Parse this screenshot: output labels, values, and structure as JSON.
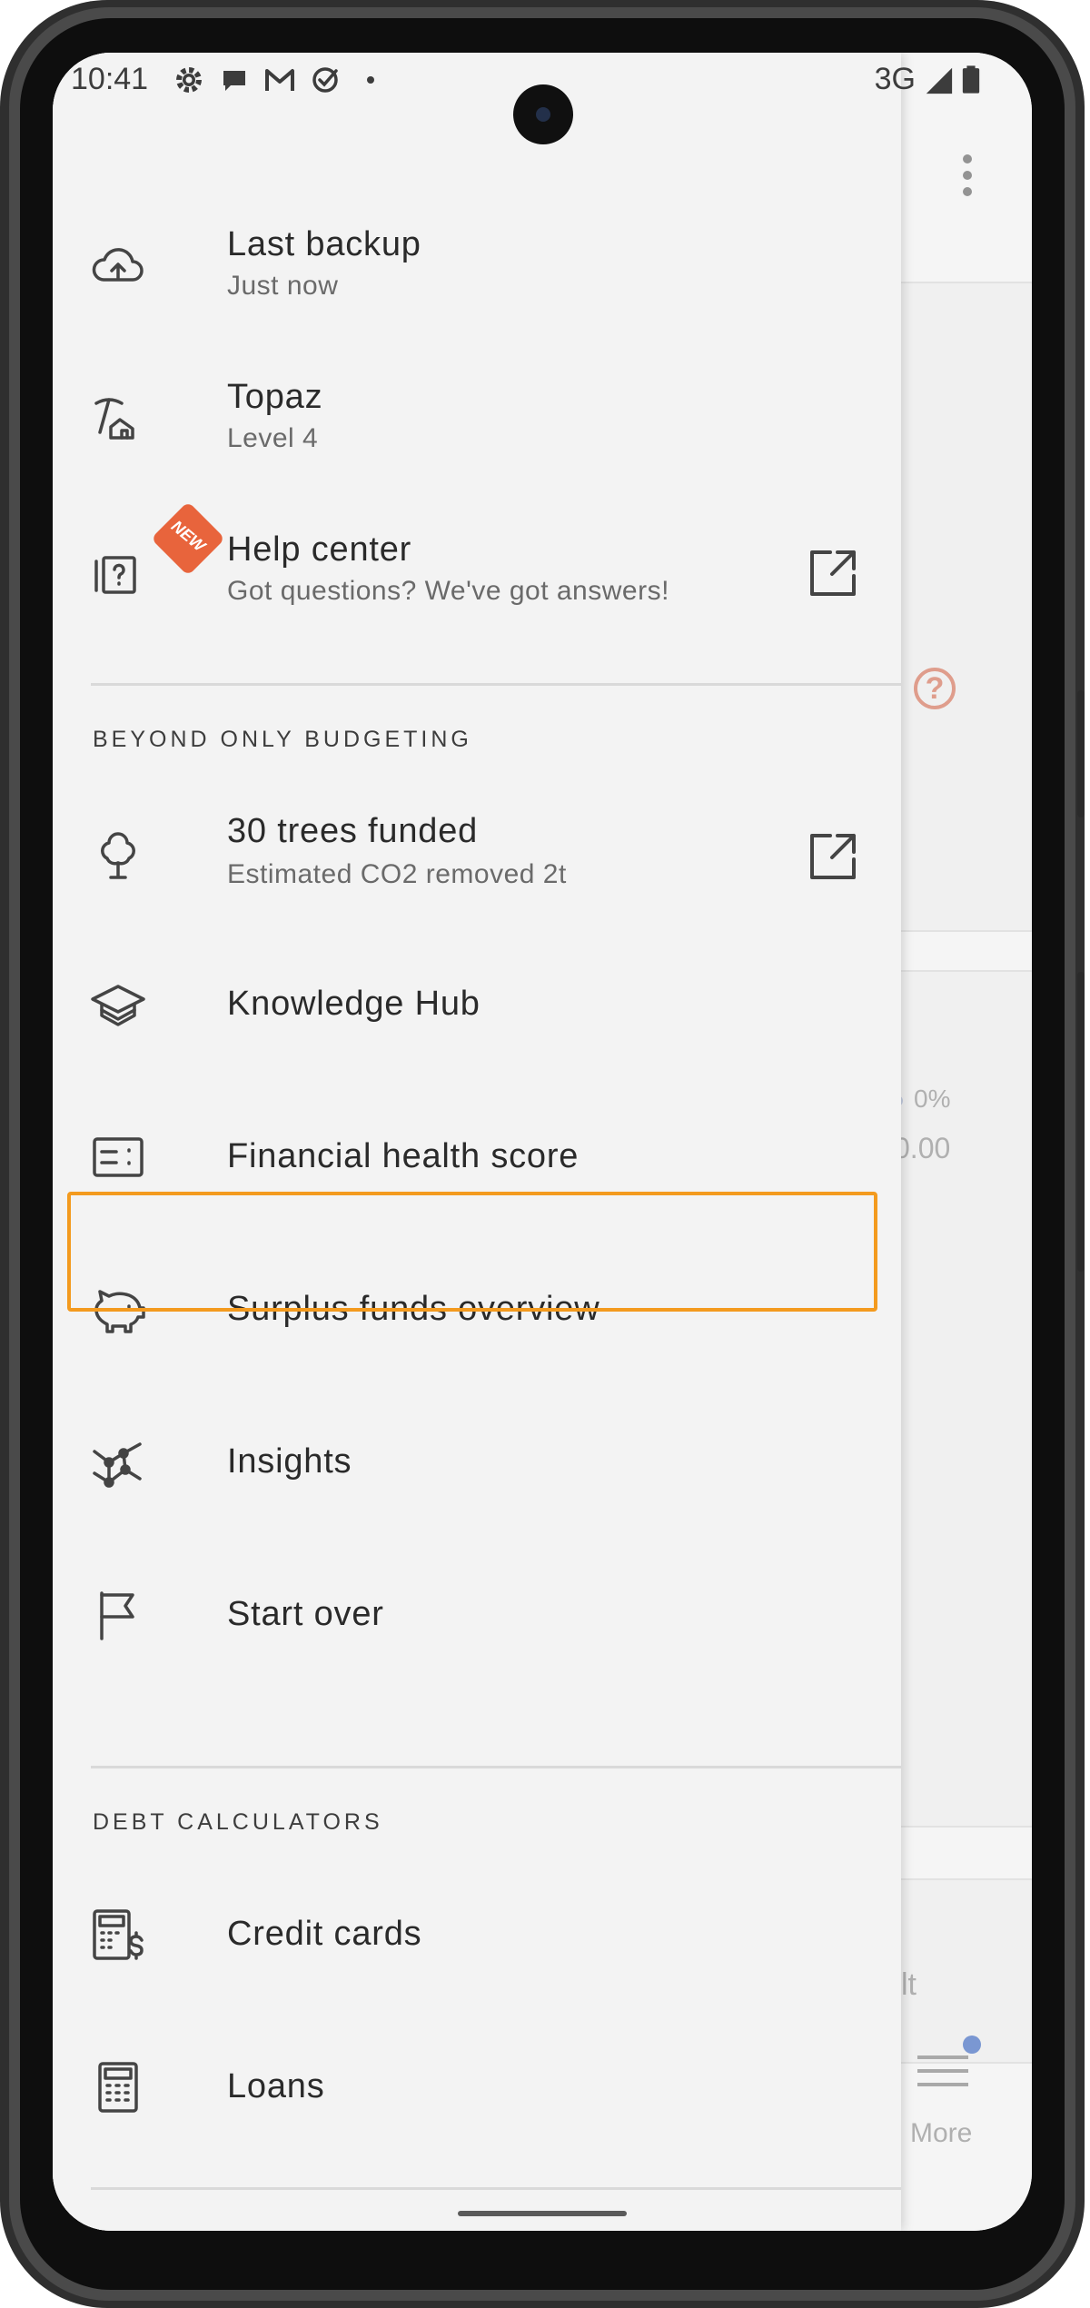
{
  "status_bar": {
    "time": "10:41",
    "network": "3G",
    "notification_icons": [
      "settings-icon",
      "chat-icon",
      "gmail-icon",
      "check-icon",
      "dot-icon"
    ]
  },
  "drawer": {
    "items_top": [
      {
        "title": "Last backup",
        "subtitle": "Just now",
        "icon": "cloud-upload-icon"
      },
      {
        "title": "Topaz",
        "subtitle": "Level 4",
        "icon": "pickaxe-icon"
      },
      {
        "title": "Help center",
        "subtitle": "Got questions? We've got answers!",
        "icon": "help-center-icon",
        "badge": "NEW",
        "external": true
      }
    ],
    "section_beyond": {
      "header": "BEYOND ONLY BUDGETING",
      "items": [
        {
          "title": "30 trees funded",
          "subtitle": "Estimated CO2 removed 2t",
          "icon": "tree-icon",
          "external": true
        },
        {
          "title": "Knowledge Hub",
          "icon": "graduation-cap-icon"
        },
        {
          "title": "Financial health score",
          "icon": "score-card-icon"
        },
        {
          "title": "Surplus funds overview",
          "icon": "piggy-bank-icon",
          "highlighted": true
        },
        {
          "title": "Insights",
          "icon": "insights-icon"
        },
        {
          "title": "Start over",
          "icon": "flag-icon"
        }
      ]
    },
    "section_debt": {
      "header": "DEBT CALCULATORS",
      "items": [
        {
          "title": "Credit cards",
          "icon": "credit-calculator-icon"
        },
        {
          "title": "Loans",
          "icon": "calculator-icon"
        }
      ]
    }
  },
  "background": {
    "percent": "0%",
    "amount": "0.00",
    "partial_text": "lt",
    "nav_more_label": "More"
  },
  "colors": {
    "drawer_bg": "#f3f3f3",
    "highlight": "#f39a1e",
    "new_badge": "#e8643c",
    "text_primary": "#2a2a2a",
    "text_secondary": "#6a6a6a"
  }
}
